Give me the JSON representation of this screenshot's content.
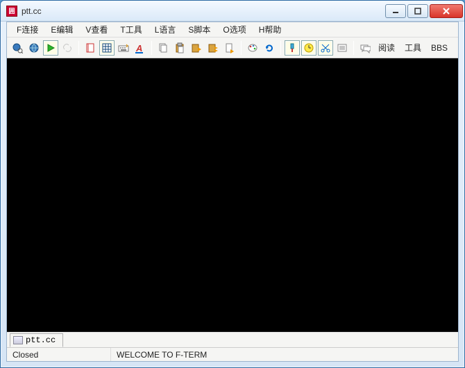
{
  "window": {
    "title": "ptt.cc"
  },
  "menu": {
    "items": [
      {
        "label": "F连接"
      },
      {
        "label": "E编辑"
      },
      {
        "label": "V查看"
      },
      {
        "label": "T工具"
      },
      {
        "label": "L语言"
      },
      {
        "label": "S脚本"
      },
      {
        "label": "O选项"
      },
      {
        "label": "H帮助"
      }
    ]
  },
  "toolbar_text": {
    "read": "阅读",
    "tools": "工具",
    "bbs": "BBS"
  },
  "tab": {
    "label": "ptt.cc"
  },
  "status": {
    "state": "Closed",
    "message": "WELCOME TO F-TERM"
  }
}
